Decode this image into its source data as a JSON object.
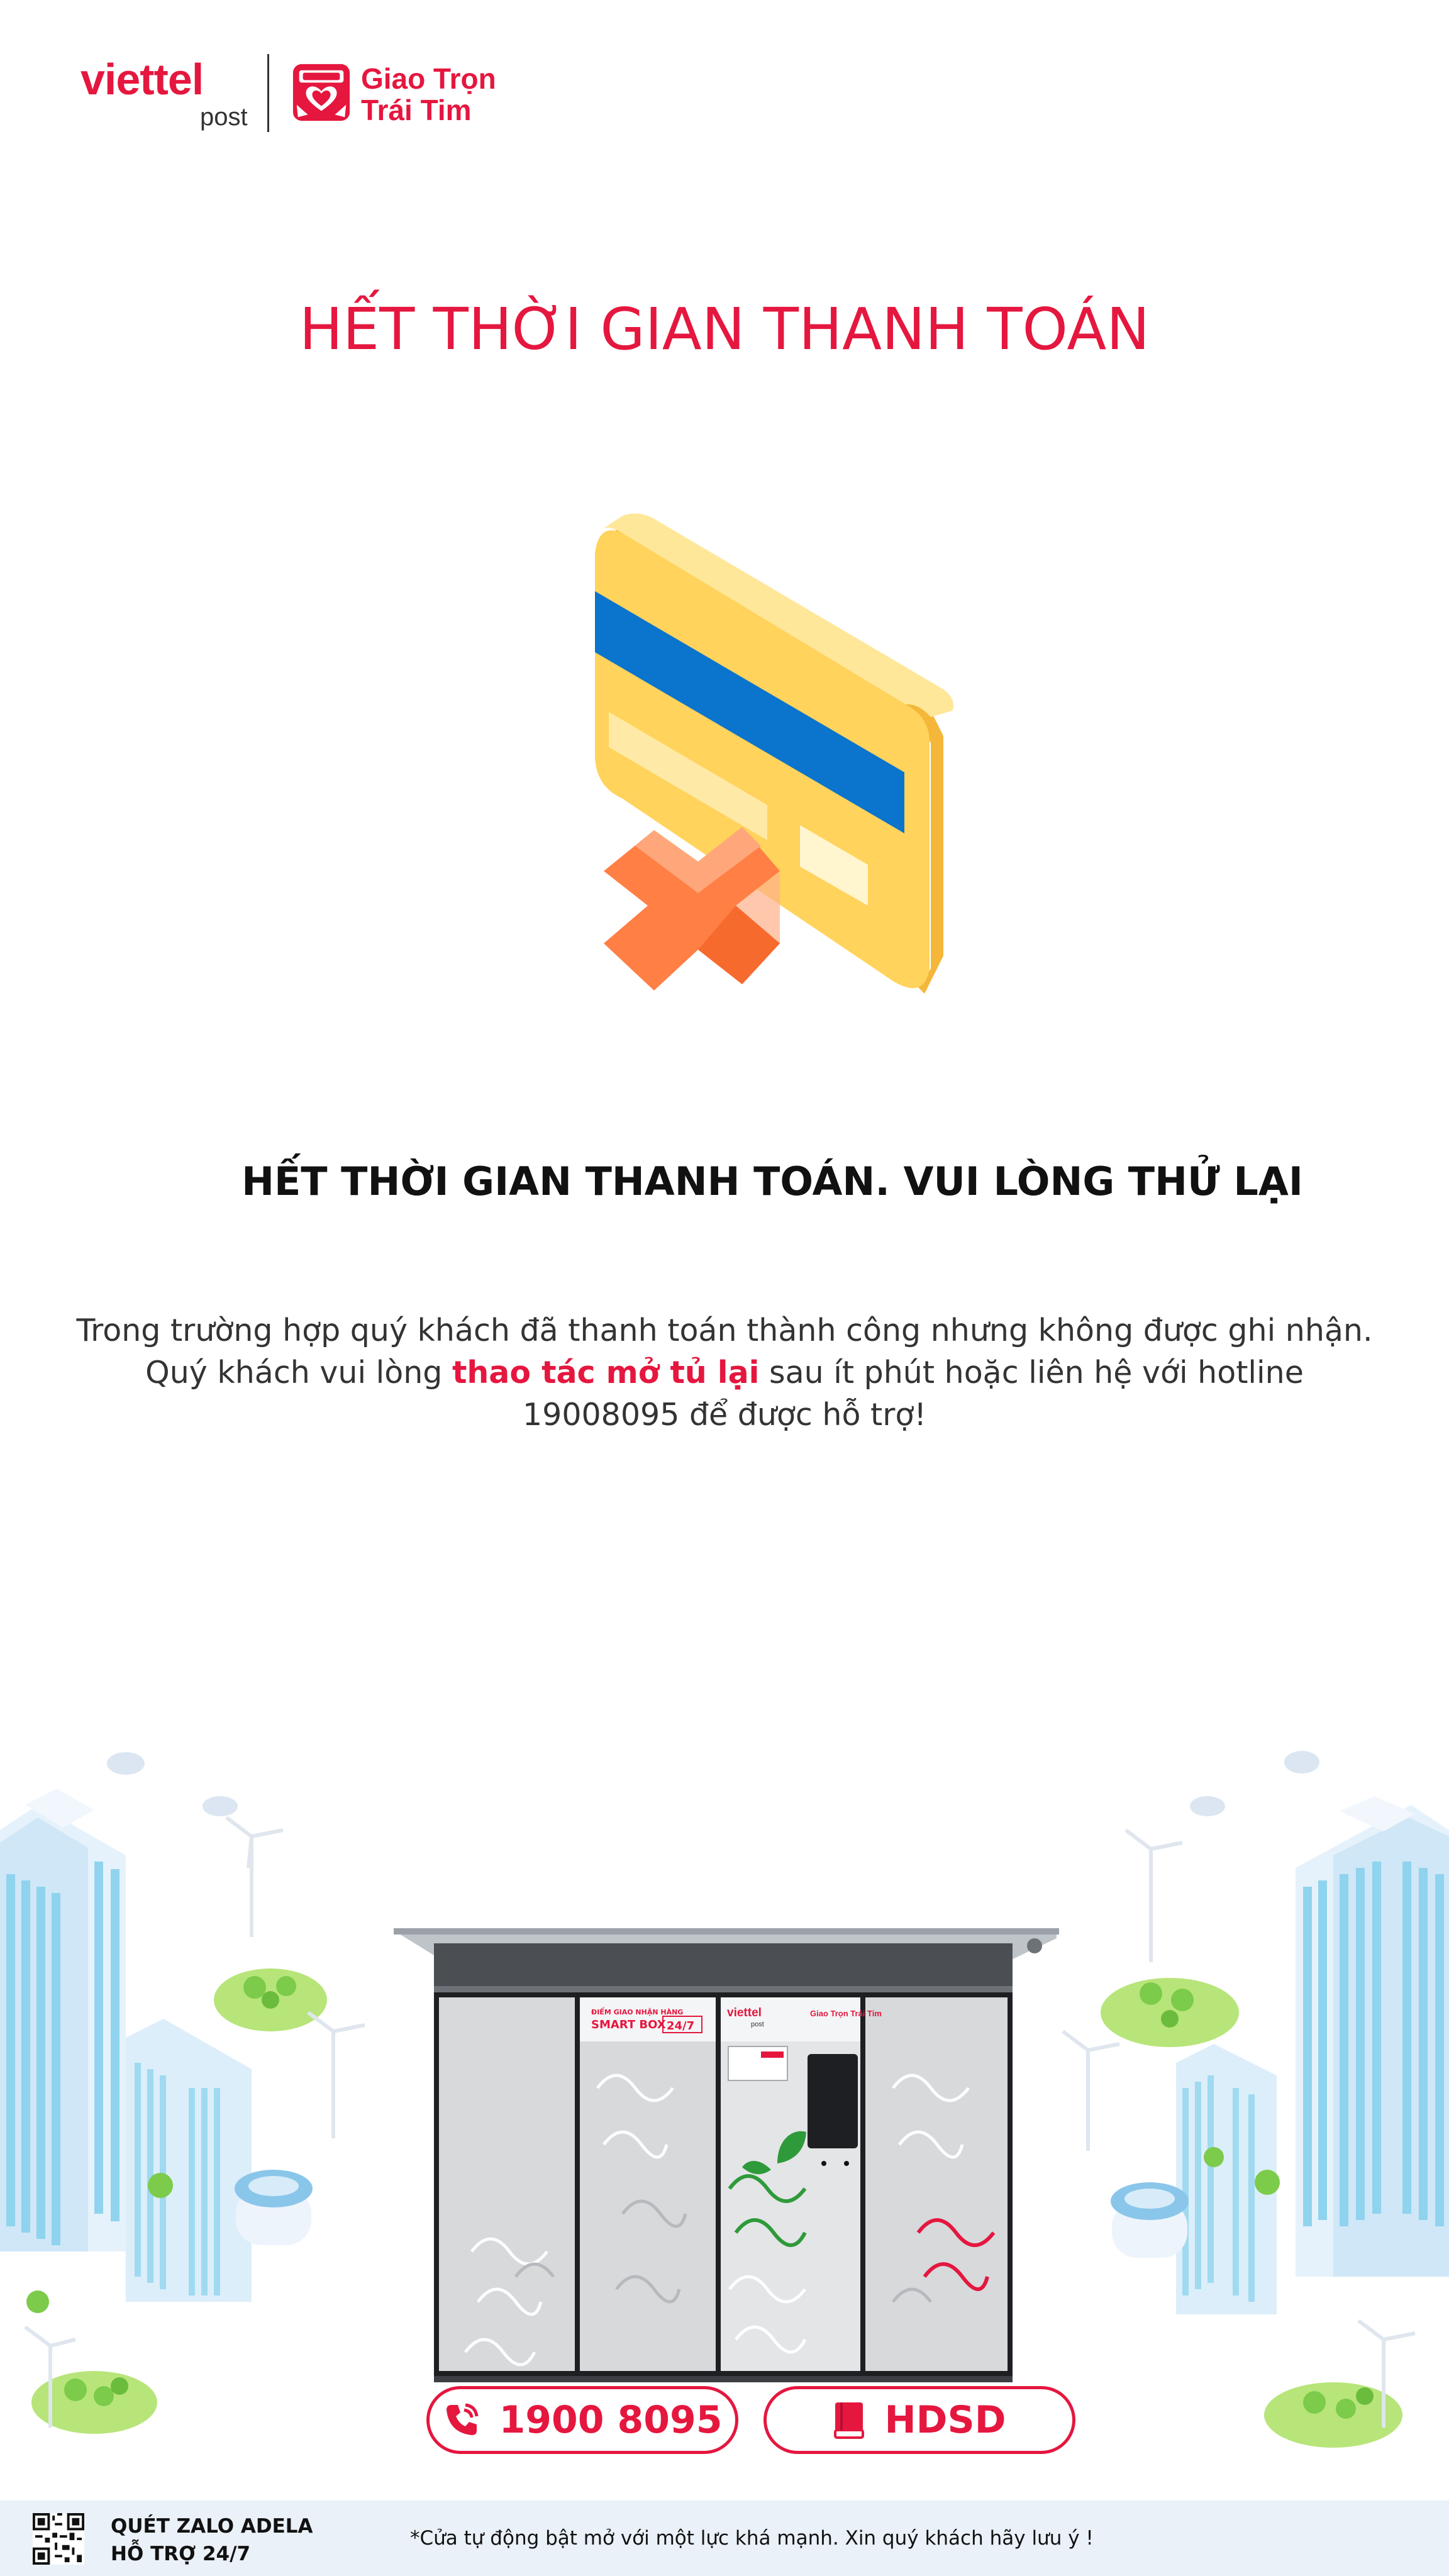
{
  "brand": {
    "wordmark": "viettel",
    "sub": "post",
    "tagline_line1": "Giao Trọn",
    "tagline_line2": "Trái Tim",
    "color": "#e5173f"
  },
  "page_title": "HẾT THỜI GIAN THANH TOÁN",
  "subtitle": "HẾT THỜI GIAN THANH TOÁN. VUI LÒNG THỬ LẠI",
  "message": {
    "line1": "Trong trường hợp quý khách đã thanh toán thành công nhưng không được ghi nhận.",
    "line2_before": "Quý khách vui lòng ",
    "line2_highlight": "thao tác mở tủ lại",
    "line2_after": " sau ít phút hoặc liên hệ với hotline",
    "line3": "19008095 để được hỗ trợ!"
  },
  "locker": {
    "panel_top_line1": "ĐIỂM GIAO NHẬN HÀNG",
    "panel_top_line2": "SMART BOX",
    "panel_badge": "24/7",
    "brand_small": "viettel",
    "brand_small_sub": "post",
    "tagline_small": "Giao Trọn Trái Tim"
  },
  "buttons": {
    "hotline": {
      "label": "1900 8095",
      "icon": "phone-icon"
    },
    "manual": {
      "label": "HDSD",
      "icon": "book-icon"
    }
  },
  "footer": {
    "zalo_line1": "QUÉT ZALO ADELA",
    "zalo_line2": "HỖ TRỢ 24/7",
    "note": "*Cửa tự động bật mở với một lực khá mạnh. Xin quý khách hãy lưu ý !",
    "background": "#eaf1f8"
  },
  "colors": {
    "accent": "#e5173f",
    "card_yellow": "#ffd35c",
    "card_stripe": "#0b74cc",
    "cross_orange": "#ff7f45"
  }
}
